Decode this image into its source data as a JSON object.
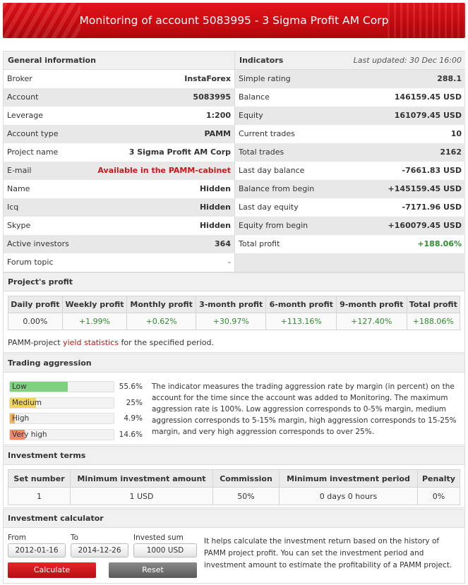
{
  "banner": {
    "title": "Monitoring of account 5083995 - 3 Sigma Profit AM Corp"
  },
  "general": {
    "header": "General information",
    "rows": [
      {
        "label": "Broker",
        "value": "InstaForex"
      },
      {
        "label": "Account",
        "value": "5083995"
      },
      {
        "label": "Leverage",
        "value": "1:200"
      },
      {
        "label": "Account type",
        "value": "PAMM"
      },
      {
        "label": "Project name",
        "value": "3 Sigma Profit AM Corp"
      },
      {
        "label": "E-mail",
        "value": "Available in the PAMM-cabinet"
      },
      {
        "label": "Name",
        "value": "Hidden"
      },
      {
        "label": "Icq",
        "value": "Hidden"
      },
      {
        "label": "Skype",
        "value": "Hidden"
      },
      {
        "label": "Active investors",
        "value": "364"
      },
      {
        "label": "Forum topic",
        "value": "-"
      }
    ]
  },
  "indicators": {
    "header": "Indicators",
    "updated": "Last updated: 30 Dec 16:00",
    "rows": [
      {
        "label": "Simple rating",
        "value": "288.1"
      },
      {
        "label": "Balance",
        "value": "146159.45 USD"
      },
      {
        "label": "Equity",
        "value": "161079.45 USD"
      },
      {
        "label": "Current trades",
        "value": "10"
      },
      {
        "label": "Total trades",
        "value": "2162"
      },
      {
        "label": "Last day balance",
        "value": "-7661.83 USD"
      },
      {
        "label": "Balance from begin",
        "value": "+145159.45 USD"
      },
      {
        "label": "Last day equity",
        "value": "-7171.96 USD"
      },
      {
        "label": "Equity from begin",
        "value": "+160079.45 USD"
      },
      {
        "label": "Total profit",
        "value": "+188.06%"
      }
    ]
  },
  "profit": {
    "header": "Project's profit",
    "columns": [
      "Daily profit",
      "Weekly profit",
      "Monthly profit",
      "3-month profit",
      "6-month profit",
      "9-month profit",
      "Total profit"
    ],
    "values": [
      "0.00%",
      "+1.99%",
      "+0.62%",
      "+30.97%",
      "+113.16%",
      "+127.40%",
      "+188.06%"
    ],
    "yield_prefix": "PAMM-project ",
    "yield_link": "yield statistics",
    "yield_suffix": " for the specified period."
  },
  "aggression": {
    "header": "Trading aggression",
    "bars": [
      {
        "label": "Low",
        "percent": "55.6%",
        "fill": 0.556,
        "color": "#7fd07f"
      },
      {
        "label": "Medium",
        "percent": "25%",
        "fill": 0.25,
        "color": "#f2d45a"
      },
      {
        "label": "High",
        "percent": "4.9%",
        "fill": 0.049,
        "color": "#f2b25a"
      },
      {
        "label": "Very high",
        "percent": "14.6%",
        "fill": 0.146,
        "color": "#ee8a6a"
      }
    ],
    "description": "The indicator measures the trading aggression rate by margin (in percent) on the account for the time since the account was added to Monitoring. The maximum aggression rate is 100%. Low aggression corresponds to 0-5% margin, medium aggression corresponds to 5-15% margin, high aggression corresponds to 15-25% margin, and very high aggression corresponds to over 25%."
  },
  "terms": {
    "header": "Investment terms",
    "columns": [
      "Set number",
      "Minimum investment amount",
      "Commission",
      "Minimum investment period",
      "Penalty"
    ],
    "values": [
      "1",
      "1 USD",
      "50%",
      "0 days 0 hours",
      "0%"
    ]
  },
  "calculator": {
    "header": "Investment calculator",
    "from_label": "From",
    "from_value": "2012-01-16",
    "to_label": "To",
    "to_value": "2014-12-26",
    "sum_label": "Invested sum",
    "sum_value": "1000 USD",
    "calculate_label": "Calculate",
    "reset_label": "Reset",
    "description": "It helps calculate the investment return based on the history of PAMM project profit. You can set the investment period and investment amount to estimate the profitability of a PAMM project."
  }
}
